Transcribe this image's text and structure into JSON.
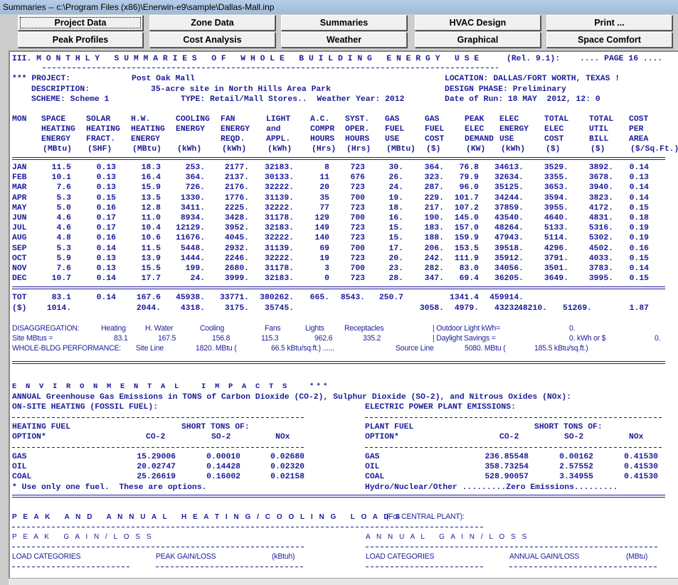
{
  "window": {
    "title": "Summaries -- c:\\Program Files (x86)\\Enerwin-e9\\sample\\Dallas-Mall.inp"
  },
  "toolbar": {
    "buttons": [
      "Project Data",
      "Zone Data",
      "Summaries",
      "HVAC Design",
      "Print ...",
      "Peak Profiles",
      "Cost Analysis",
      "Weather",
      "Graphical",
      "Space Comfort"
    ]
  },
  "report": {
    "title": "III. M O N T H L Y   S U M M A R I E S   O F   W H O L E   B U I L D I N G   E N E R G Y   U S E",
    "release": "(Rel. 9.1):",
    "page": ".... PAGE 16 ....",
    "project_label": "*** PROJECT:",
    "project": "Post Oak Mall",
    "description_label": "DESCRIPTION:",
    "description": "35-acre site in North Hills Area Park",
    "scheme": "SCHEME: Scheme 1",
    "type": "TYPE: Retail/Mall Stores..  Weather Year: 2012",
    "location": "LOCATION: DALLAS/FORT WORTH, TEXAS !",
    "design_phase": "DESIGN PHASE: Preliminary",
    "date_of_run": "Date of Run: 18 MAY  2012, 12: 0",
    "mon_header": "MON",
    "columns": [
      [
        "SPACE",
        "HEATING",
        "ENERGY",
        "(MBtu)"
      ],
      [
        "SOLAR",
        "HEATING",
        "FRACT.",
        "(SHF)"
      ],
      [
        "H.W.",
        "HEATING",
        "ENERGY",
        "(MBtu)"
      ],
      [
        "COOLING",
        "ENERGY",
        "",
        "(kWh)"
      ],
      [
        "FAN",
        "ENERGY",
        "REQD.",
        "(kWh)"
      ],
      [
        "LIGHT",
        "and",
        "APPL.",
        "(kWh)"
      ],
      [
        "A.C.",
        "COMPR",
        "HOURS",
        "(Hrs)"
      ],
      [
        "SYST.",
        "OPER.",
        "HOURS",
        "(Hrs)"
      ],
      [
        "GAS",
        "FUEL",
        "USE",
        "(MBtu)"
      ],
      [
        "GAS",
        "FUEL",
        "COST",
        "($)"
      ],
      [
        "PEAK",
        "ELEC",
        "DEMAND",
        "(KW)"
      ],
      [
        "ELEC",
        "ENERGY",
        "USE",
        "(kWh)"
      ],
      [
        "TOTAL",
        "ELEC",
        "COST",
        "($)"
      ],
      [
        "TOTAL",
        "UTIL",
        "BILL",
        "($)"
      ],
      [
        "COST",
        "PER",
        "AREA",
        "($/Sq.Ft.)"
      ]
    ],
    "months": [
      [
        "JAN",
        "11.5",
        "0.13",
        "18.3",
        "253.",
        "2177.",
        "32183.",
        "8",
        "723",
        "30.",
        "364.",
        "76.8",
        "34613.",
        "3529.",
        "3892.",
        "0.14"
      ],
      [
        "FEB",
        "10.1",
        "0.13",
        "16.4",
        "364.",
        "2137.",
        "30133.",
        "11",
        "676",
        "26.",
        "323.",
        "79.9",
        "32634.",
        "3355.",
        "3678.",
        "0.13"
      ],
      [
        "MAR",
        "7.6",
        "0.13",
        "15.9",
        "726.",
        "2176.",
        "32222.",
        "20",
        "723",
        "24.",
        "287.",
        "96.0",
        "35125.",
        "3653.",
        "3940.",
        "0.14"
      ],
      [
        "APR",
        "5.3",
        "0.15",
        "13.5",
        "1330.",
        "1776.",
        "31139.",
        "35",
        "700",
        "19.",
        "229.",
        "101.7",
        "34244.",
        "3594.",
        "3823.",
        "0.14"
      ],
      [
        "MAY",
        "5.0",
        "0.16",
        "12.8",
        "3411.",
        "2225.",
        "32222.",
        "77",
        "723",
        "18.",
        "217.",
        "107.2",
        "37859.",
        "3955.",
        "4172.",
        "0.15"
      ],
      [
        "JUN",
        "4.6",
        "0.17",
        "11.0",
        "8934.",
        "3428.",
        "31178.",
        "129",
        "700",
        "16.",
        "190.",
        "145.0",
        "43540.",
        "4640.",
        "4831.",
        "0.18"
      ],
      [
        "JUL",
        "4.6",
        "0.17",
        "10.4",
        "12129.",
        "3952.",
        "32183.",
        "149",
        "723",
        "15.",
        "183.",
        "157.0",
        "48264.",
        "5133.",
        "5316.",
        "0.19"
      ],
      [
        "AUG",
        "4.8",
        "0.16",
        "10.6",
        "11676.",
        "4045.",
        "32222.",
        "140",
        "723",
        "15.",
        "188.",
        "159.9",
        "47943.",
        "5114.",
        "5302.",
        "0.19"
      ],
      [
        "SEP",
        "5.3",
        "0.14",
        "11.5",
        "5448.",
        "2932.",
        "31139.",
        "69",
        "700",
        "17.",
        "206.",
        "153.5",
        "39518.",
        "4296.",
        "4502.",
        "0.16"
      ],
      [
        "OCT",
        "5.9",
        "0.13",
        "13.9",
        "1444.",
        "2246.",
        "32222.",
        "19",
        "723",
        "20.",
        "242.",
        "111.9",
        "35912.",
        "3791.",
        "4033.",
        "0.15"
      ],
      [
        "NOV",
        "7.6",
        "0.13",
        "15.5",
        "199.",
        "2680.",
        "31178.",
        "3",
        "700",
        "23.",
        "282.",
        "83.0",
        "34056.",
        "3501.",
        "3783.",
        "0.14"
      ],
      [
        "DEC",
        "10.7",
        "0.14",
        "17.7",
        "24.",
        "3999.",
        "32183.",
        "0",
        "723",
        "28.",
        "347.",
        "69.4",
        "36205.",
        "3649.",
        "3995.",
        "0.15"
      ]
    ],
    "total": [
      "TOT",
      "83.1",
      "0.14",
      "167.6",
      "45938.",
      "33771.",
      "380262.",
      "665.",
      "8543.",
      "250.7",
      "",
      "1341.4",
      "459914.",
      "",
      "",
      ""
    ],
    "cost": [
      "($)",
      "1014.",
      "",
      "2044.",
      "4318.",
      "3175.",
      "35745.",
      "",
      "",
      "",
      "3058.",
      "4979.",
      "43232.",
      "48210.",
      "51269.",
      "1.87"
    ],
    "disagg": {
      "label": "DISAGGREGATION:",
      "headers": [
        "Heating",
        "H. Water",
        "Cooling",
        "Fans",
        "Lights",
        "Receptacles"
      ],
      "site_label": "Site MBtus =",
      "values": [
        "83.1",
        "167.5",
        "156.8",
        "115.3",
        "962.6",
        "335.2"
      ],
      "outdoor_label": "| Outdoor Light kWh=",
      "outdoor_value": "0.",
      "daylight_label": "| Daylight Savings =",
      "daylight_value": "0. kWh or $",
      "daylight_cost": "0."
    },
    "whole": {
      "label": "WHOLE-BLDG PERFORMANCE:",
      "site": "Site Line",
      "site_mbtu": "1820. MBtu (",
      "site_intensity": "66.5 kBtu/sq.ft.) ......",
      "source": "Source Line",
      "source_mbtu": "5080. MBtu (",
      "source_intensity": "185.5 kBtu/sq.ft.)"
    },
    "env": {
      "title": "E N V I R O N M E N T A L   I M P A C T S   ***",
      "subtitle": "ANNUAL Greenhouse Gas Emissions in TONS of Carbon Dioxide (CO-2), Sulphur Dioxide (SO-2), and Nitrous Oxides (NOx):",
      "onsite_title": "ON-SITE HEATING (FOSSIL FUEL):",
      "plant_title": "ELECTRIC POWER PLANT EMISSIONS:",
      "onsite_h1": "HEATING FUEL",
      "plant_h1": "PLANT FUEL",
      "short_tons": "SHORT TONS OF:",
      "option": "OPTION*",
      "gases": [
        "CO-2",
        "SO-2",
        "NOx"
      ],
      "onsite_rows": [
        [
          "GAS",
          "15.29006",
          "0.00010",
          "0.02680"
        ],
        [
          "OIL",
          "20.02747",
          "0.14428",
          "0.02320"
        ],
        [
          "COAL",
          "25.26619",
          "0.16002",
          "0.02158"
        ]
      ],
      "plant_rows": [
        [
          "GAS",
          "236.85548",
          "0.00162",
          "0.41530"
        ],
        [
          "OIL",
          "358.73254",
          "2.57552",
          "0.41530"
        ],
        [
          "COAL",
          "528.90057",
          "3.34955",
          "0.41530"
        ]
      ],
      "onsite_note": "* Use only one fuel.  These are options.",
      "plant_note": "Hydro/Nuclear/Other .........Zero Emissions........."
    },
    "loads": {
      "title": "P E A K   A N D   A N N U A L   H E A T I N G / C O O L I N G   L O A D S",
      "title_note": "(For CENTRAL PLANT):",
      "peak_title": "P E A K   G A I N / L O S S",
      "annual_title": "A N N U A L   G A I N / L O S S",
      "load_categories": "LOAD CATEGORIES",
      "peak_col": "PEAK GAIN/LOSS",
      "peak_unit": "(kBtuh)",
      "annual_col": "ANNUAL GAIN/LOSS",
      "annual_unit": "(MBtu)"
    }
  },
  "colors": {
    "report_text": "#1c1c9a",
    "background": "#cdcdcd"
  }
}
